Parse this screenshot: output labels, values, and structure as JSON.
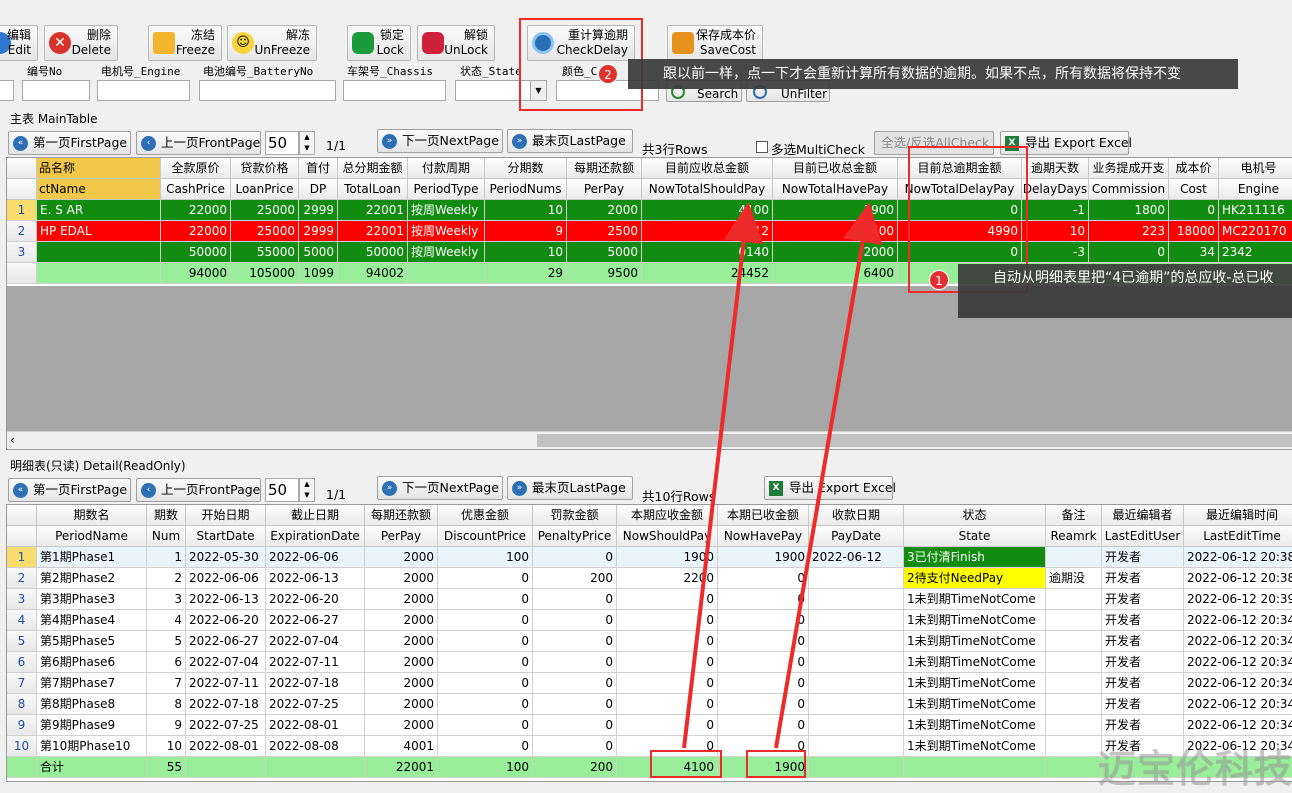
{
  "toolbar": {
    "edit": {
      "cn": "编辑",
      "en": "Edit"
    },
    "delete": {
      "cn": "删除",
      "en": "Delete"
    },
    "freeze": {
      "cn": "冻结",
      "en": "Freeze"
    },
    "unfreeze": {
      "cn": "解冻",
      "en": "UnFreeze"
    },
    "lock": {
      "cn": "锁定",
      "en": "Lock"
    },
    "unlock": {
      "cn": "解锁",
      "en": "UnLock"
    },
    "check_delay": {
      "cn": "重计算逾期",
      "en": "CheckDelay"
    },
    "save_cost": {
      "cn": "保存成本价",
      "en": "SaveCost"
    },
    "search_label": "Search",
    "unfilter_label": "UnFilter"
  },
  "filters": {
    "no": "编号No",
    "engine": "电机号_Engine",
    "battery": "电池编号_BatteryNo",
    "chassis": "车架号_Chassis",
    "state": "状态_State",
    "color": "颜色_C"
  },
  "main": {
    "section_label": "主表 MainTable",
    "pager": {
      "first": "第一页FirstPage",
      "front": "上一页FrontPage",
      "page_size": "50",
      "page_info": "1/1",
      "next": "下一页NextPage",
      "last": "最末页LastPage",
      "rows_info": "共3行Rows",
      "multi_check": "多选MultiCheck",
      "all_check": "全选/反选AllCheck",
      "export": "导出 Export Excel"
    },
    "headers_cn": [
      "品名称",
      "全款原价",
      "贷款价格",
      "首付",
      "总分期金额",
      "付款周期",
      "分期数",
      "每期还款额",
      "目前应收总金额",
      "目前已收总金额",
      "目前总逾期金额",
      "逾期天数",
      "业务提成开支",
      "成本价",
      "电机号"
    ],
    "headers_en": [
      "ctName",
      "CashPrice",
      "LoanPrice",
      "DP",
      "TotalLoan",
      "PeriodType",
      "PeriodNums",
      "PerPay",
      "NowTotalShouldPay",
      "NowTotalHavePay",
      "NowTotalDelayPay",
      "DelayDays",
      "Commission",
      "Cost",
      "Engine"
    ],
    "rows": [
      {
        "n": "1",
        "name": "E.         S AR",
        "cash": "22000",
        "loan": "25000",
        "dp": "2999",
        "total": "22001",
        "ptype": "按周Weekly",
        "nums": "10",
        "per": "2000",
        "should": "4100",
        "have": "1900",
        "delay": "0",
        "days": "-1",
        "comm": "1800",
        "cost": "0",
        "engine": "HK211116"
      },
      {
        "n": "2",
        "name": "HP            EDAL",
        "cash": "22000",
        "loan": "25000",
        "dp": "2999",
        "total": "22001",
        "ptype": "按周Weekly",
        "nums": "9",
        "per": "2500",
        "should": "0212",
        "have": "2500",
        "delay": "4990",
        "days": "10",
        "comm": "223",
        "cost": "18000",
        "engine": "MC220170"
      },
      {
        "n": "3",
        "name": "",
        "cash": "50000",
        "loan": "55000",
        "dp": "5000",
        "total": "50000",
        "ptype": "按周Weekly",
        "nums": "10",
        "per": "5000",
        "should": "0140",
        "have": "2000",
        "delay": "0",
        "days": "-3",
        "comm": "0",
        "cost": "34",
        "engine": "2342"
      }
    ],
    "totals": {
      "cash": "94000",
      "loan": "105000",
      "dp": "1099",
      "total": "94002",
      "nums": "29",
      "per": "9500",
      "should": "24452",
      "have": "6400"
    }
  },
  "detail": {
    "section_label": "明细表(只读) Detail(ReadOnly)",
    "pager": {
      "first": "第一页FirstPage",
      "front": "上一页FrontPage",
      "page_size": "50",
      "page_info": "1/1",
      "next": "下一页NextPage",
      "last": "最末页LastPage",
      "rows_info": "共10行Rows",
      "export": "导出 Export Excel"
    },
    "headers_cn": [
      "期数名",
      "期数",
      "开始日期",
      "截止日期",
      "每期还款额",
      "优惠金额",
      "罚款金额",
      "本期应收金额",
      "本期已收金额",
      "收款日期",
      "状态",
      "备注",
      "最近编辑者",
      "最近编辑时间"
    ],
    "headers_en": [
      "PeriodName",
      "Num",
      "StartDate",
      "ExpirationDate",
      "PerPay",
      "DiscountPrice",
      "PenaltyPrice",
      "NowShouldPay",
      "NowHavePay",
      "PayDate",
      "State",
      "Reamrk",
      "LastEditUser",
      "LastEditTime"
    ],
    "rows": [
      {
        "n": "1",
        "name": "第1期Phase1",
        "num": "1",
        "start": "2022-05-30",
        "end": "2022-06-06",
        "per": "2000",
        "disc": "100",
        "pen": "0",
        "should": "1900",
        "have": "1900",
        "paydate": "2022-06-12",
        "state": "3已付清Finish",
        "remark": "",
        "user": "开发者",
        "time": "2022-06-12 20:38"
      },
      {
        "n": "2",
        "name": "第2期Phase2",
        "num": "2",
        "start": "2022-06-06",
        "end": "2022-06-13",
        "per": "2000",
        "disc": "0",
        "pen": "200",
        "should": "2200",
        "have": "0",
        "paydate": "",
        "state": "2待支付NeedPay",
        "remark": "逾期没",
        "user": "开发者",
        "time": "2022-06-12 20:38"
      },
      {
        "n": "3",
        "name": "第3期Phase3",
        "num": "3",
        "start": "2022-06-13",
        "end": "2022-06-20",
        "per": "2000",
        "disc": "0",
        "pen": "0",
        "should": "0",
        "have": "0",
        "paydate": "",
        "state": "1未到期TimeNotCome",
        "remark": "",
        "user": "开发者",
        "time": "2022-06-12 20:39"
      },
      {
        "n": "4",
        "name": "第4期Phase4",
        "num": "4",
        "start": "2022-06-20",
        "end": "2022-06-27",
        "per": "2000",
        "disc": "0",
        "pen": "0",
        "should": "0",
        "have": "0",
        "paydate": "",
        "state": "1未到期TimeNotCome",
        "remark": "",
        "user": "开发者",
        "time": "2022-06-12 20:34"
      },
      {
        "n": "5",
        "name": "第5期Phase5",
        "num": "5",
        "start": "2022-06-27",
        "end": "2022-07-04",
        "per": "2000",
        "disc": "0",
        "pen": "0",
        "should": "0",
        "have": "0",
        "paydate": "",
        "state": "1未到期TimeNotCome",
        "remark": "",
        "user": "开发者",
        "time": "2022-06-12 20:34"
      },
      {
        "n": "6",
        "name": "第6期Phase6",
        "num": "6",
        "start": "2022-07-04",
        "end": "2022-07-11",
        "per": "2000",
        "disc": "0",
        "pen": "0",
        "should": "0",
        "have": "0",
        "paydate": "",
        "state": "1未到期TimeNotCome",
        "remark": "",
        "user": "开发者",
        "time": "2022-06-12 20:34"
      },
      {
        "n": "7",
        "name": "第7期Phase7",
        "num": "7",
        "start": "2022-07-11",
        "end": "2022-07-18",
        "per": "2000",
        "disc": "0",
        "pen": "0",
        "should": "0",
        "have": "0",
        "paydate": "",
        "state": "1未到期TimeNotCome",
        "remark": "",
        "user": "开发者",
        "time": "2022-06-12 20:34"
      },
      {
        "n": "8",
        "name": "第8期Phase8",
        "num": "8",
        "start": "2022-07-18",
        "end": "2022-07-25",
        "per": "2000",
        "disc": "0",
        "pen": "0",
        "should": "0",
        "have": "0",
        "paydate": "",
        "state": "1未到期TimeNotCome",
        "remark": "",
        "user": "开发者",
        "time": "2022-06-12 20:34"
      },
      {
        "n": "9",
        "name": "第9期Phase9",
        "num": "9",
        "start": "2022-07-25",
        "end": "2022-08-01",
        "per": "2000",
        "disc": "0",
        "pen": "0",
        "should": "0",
        "have": "0",
        "paydate": "",
        "state": "1未到期TimeNotCome",
        "remark": "",
        "user": "开发者",
        "time": "2022-06-12 20:34"
      },
      {
        "n": "10",
        "name": "第10期Phase10",
        "num": "10",
        "start": "2022-08-01",
        "end": "2022-08-08",
        "per": "4001",
        "disc": "0",
        "pen": "0",
        "should": "0",
        "have": "0",
        "paydate": "",
        "state": "1未到期TimeNotCome",
        "remark": "",
        "user": "开发者",
        "time": "2022-06-12 20:34"
      }
    ],
    "totals": {
      "label": "合计",
      "num": "55",
      "per": "22001",
      "disc": "100",
      "pen": "200",
      "should": "4100",
      "have": "1900"
    }
  },
  "annotations": {
    "tip1_badge": "1",
    "tip1_text": "自动从明细表里把“4已逾期”的总应收-总已收",
    "tip2_badge": "2",
    "tip2_text": "跟以前一样，点一下才会重新计算所有数据的逾期。如果不点，所有数据将保持不变"
  },
  "watermark": "迈宝伦科技",
  "colors": {
    "green": "#118c11",
    "red": "#ff0000",
    "light_green": "#99ee99",
    "yellow": "#ffff00",
    "selected": "#fff2a8",
    "annotation": "#ee2a2a"
  }
}
